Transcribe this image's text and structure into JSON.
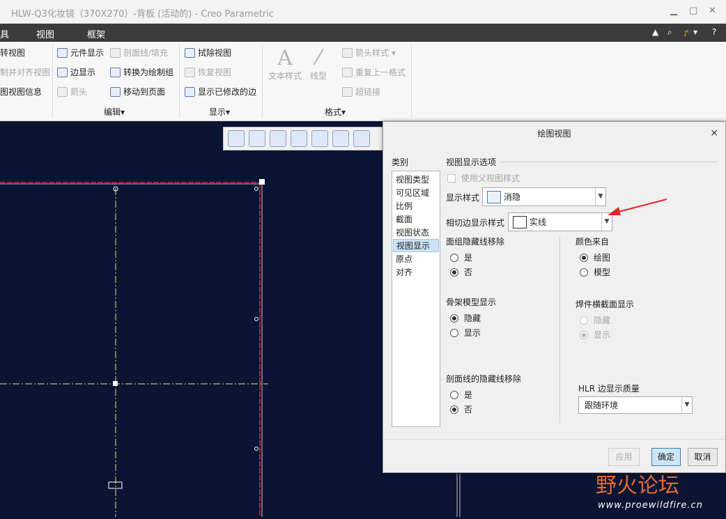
{
  "window": {
    "title": "HLW-Q3化妆镜（370X270）-背板 (活动的) - Creo Parametric",
    "minimize": "▁",
    "maximize": "□",
    "close": "✕"
  },
  "menubar": {
    "items": [
      "具",
      "视图",
      "框架"
    ],
    "right_icons": [
      "▲",
      "⌕",
      "🎓▾",
      "?"
    ]
  },
  "ribbon": {
    "col1": [
      "转视图",
      "制并对齐视图",
      "图视图信息"
    ],
    "col2": [
      "元件显示",
      "边显示",
      "箭头"
    ],
    "col3": [
      "剖面线/填充",
      "转换为绘制组",
      "移动到页面"
    ],
    "edit_group": "编辑▾",
    "col4": [
      "拭除视图",
      "恢复视图",
      "显示已修改的边"
    ],
    "display_group": "显示▾",
    "text_style": "文本样式",
    "line_style": "线型",
    "col6": [
      "箭头样式 ▾",
      "重复上一格式",
      "超链接"
    ],
    "format_group": "格式▾"
  },
  "dialog": {
    "title": "绘图视图",
    "close": "×",
    "category_label": "类别",
    "categories": [
      "视图类型",
      "可见区域",
      "比例",
      "截面",
      "视图状态",
      "视图显示",
      "原点",
      "对齐"
    ],
    "selected_category": "视图显示",
    "section_title": "视图显示选项",
    "use_parent_style": "使用父视图样式",
    "display_style_label": "显示样式",
    "display_style_value": "消隐",
    "tangent_edge_label": "相切边显示样式",
    "tangent_edge_value": "实线",
    "face_group_hidden": {
      "label": "面组隐藏线移除",
      "options": [
        "是",
        "否"
      ],
      "selected": "否"
    },
    "color_from": {
      "label": "颜色来自",
      "options": [
        "绘图",
        "模型"
      ],
      "selected": "绘图"
    },
    "skeleton_display": {
      "label": "骨架模型显示",
      "options": [
        "隐藏",
        "显示"
      ],
      "selected": "隐藏"
    },
    "weld_section": {
      "label": "焊件横截面显示",
      "options": [
        "隐藏",
        "显示"
      ],
      "selected": "显示"
    },
    "hatch_hidden": {
      "label": "剖面线的隐藏线移除",
      "options": [
        "是",
        "否"
      ],
      "selected": "否"
    },
    "hlr_quality_label": "HLR 边显示质量",
    "hlr_quality_value": "跟随环境",
    "buttons": {
      "apply": "应用",
      "ok": "确定",
      "cancel": "取消"
    }
  },
  "watermark": {
    "text": "野火论坛",
    "url": "www.proewildfire.cn"
  },
  "colors": {
    "canvas": "#0b1433",
    "sketch_red": "#d8283a",
    "centerline_yellow": "#e5e07a",
    "annotation_arrow": "#e3262b"
  }
}
